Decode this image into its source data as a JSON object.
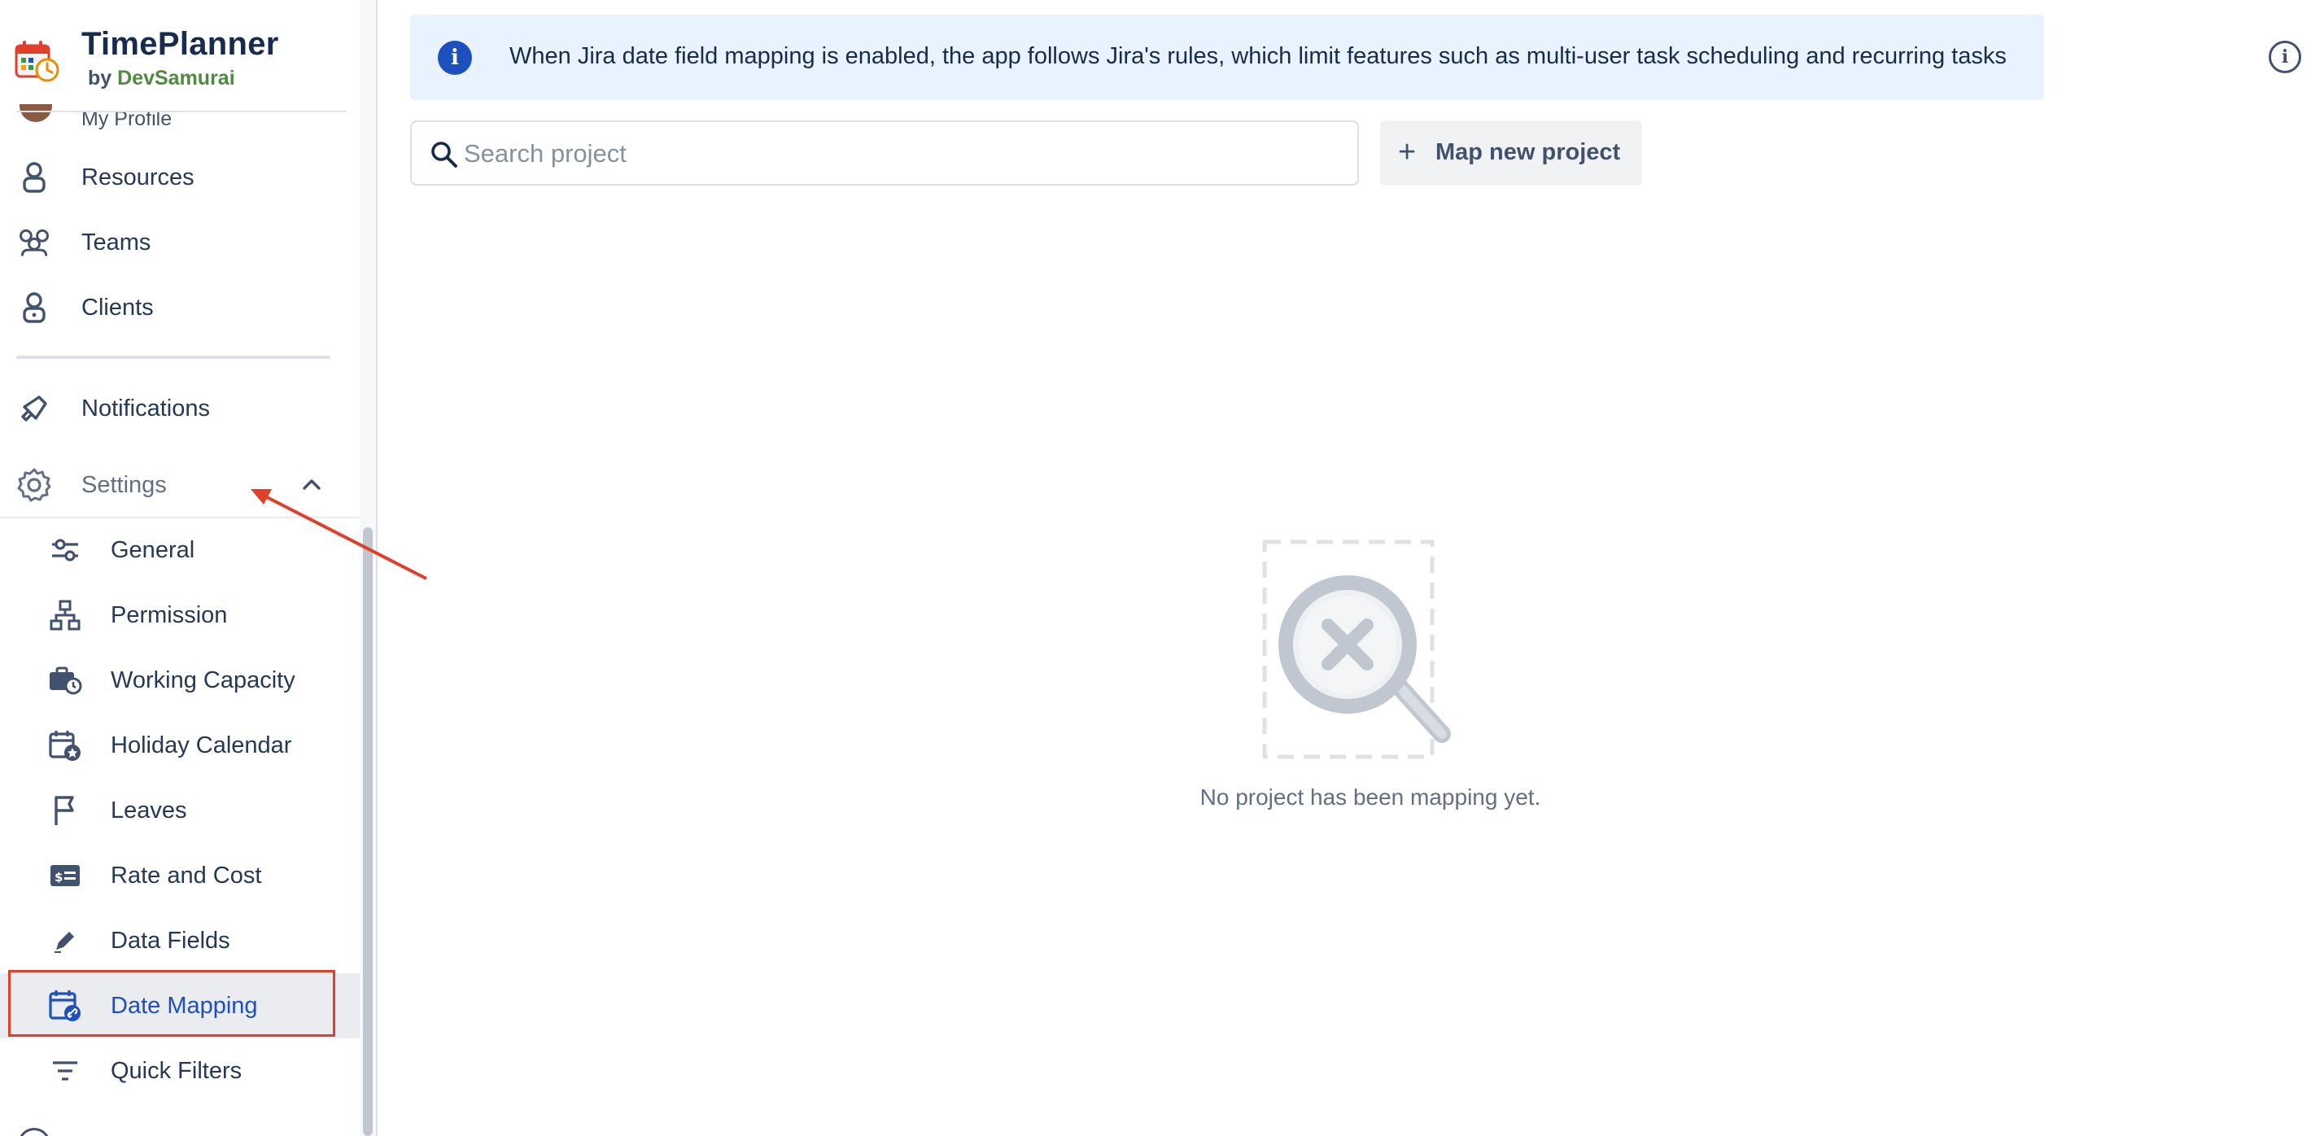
{
  "brand": {
    "title": "TimePlanner",
    "by_prefix": "by",
    "company": "DevSamurai"
  },
  "sidebar": {
    "partial_profile_label": "My Profile",
    "items": [
      {
        "label": "Resources",
        "icon": "person-lock-icon"
      },
      {
        "label": "Teams",
        "icon": "people-group-icon"
      },
      {
        "label": "Clients",
        "icon": "client-lock-icon"
      },
      {
        "label": "Notifications",
        "icon": "megaphone-icon"
      },
      {
        "label": "Settings",
        "icon": "gear-icon",
        "expanded": true
      }
    ],
    "settings_items": [
      {
        "label": "General",
        "icon": "sliders-icon"
      },
      {
        "label": "Permission",
        "icon": "hierarchy-icon"
      },
      {
        "label": "Working Capacity",
        "icon": "briefcase-clock-icon"
      },
      {
        "label": "Holiday Calendar",
        "icon": "calendar-star-icon"
      },
      {
        "label": "Leaves",
        "icon": "flag-icon"
      },
      {
        "label": "Rate and Cost",
        "icon": "money-card-icon"
      },
      {
        "label": "Data Fields",
        "icon": "pencil-icon"
      },
      {
        "label": "Date Mapping",
        "icon": "calendar-link-icon",
        "active": true
      },
      {
        "label": "Quick Filters",
        "icon": "filter-lines-icon"
      }
    ]
  },
  "banner": {
    "text": "When Jira date field mapping is enabled, the app follows Jira's rules, which limit features such as multi-user task scheduling and recurring tasks"
  },
  "search": {
    "placeholder": "Search project",
    "value": ""
  },
  "actions": {
    "map_new_project_label": "Map new project"
  },
  "empty_state": {
    "message": "No project has been mapping yet."
  },
  "colors": {
    "accent": "#1d4fbf",
    "banner_bg": "#e9f2ff",
    "annotation": "#e0402a",
    "active_bg": "#ebecf0"
  }
}
